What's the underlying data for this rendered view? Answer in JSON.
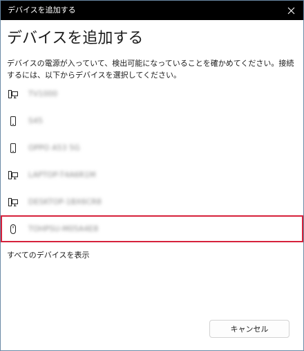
{
  "window": {
    "title": "デバイスを追加する",
    "close_icon": "close-icon"
  },
  "heading": "デバイスを追加する",
  "description": "デバイスの電源が入っていて、検出可能になっていることを確かめてください。接続するには、以下からデバイスを選択してください。",
  "devices": [
    {
      "name": "TV1000",
      "icon": "display-pc-icon",
      "selected": false
    },
    {
      "name": "S45",
      "icon": "phone-icon",
      "selected": false
    },
    {
      "name": "OPPO A53 5G",
      "icon": "phone-icon",
      "selected": false
    },
    {
      "name": "LAPTOP-T4A6R1M",
      "icon": "display-pc-icon",
      "selected": false
    },
    {
      "name": "DESKTOP-1BX6CR8",
      "icon": "display-pc-icon",
      "selected": false
    },
    {
      "name": "TOHPSU-M05A4E8",
      "icon": "mouse-icon",
      "selected": true
    }
  ],
  "show_all_label": "すべてのデバイスを表示",
  "cancel_label": "キャンセル",
  "colors": {
    "titlebar": "#000000",
    "selection_outline": "#d6203a",
    "window_border": "#6b8aa6"
  }
}
